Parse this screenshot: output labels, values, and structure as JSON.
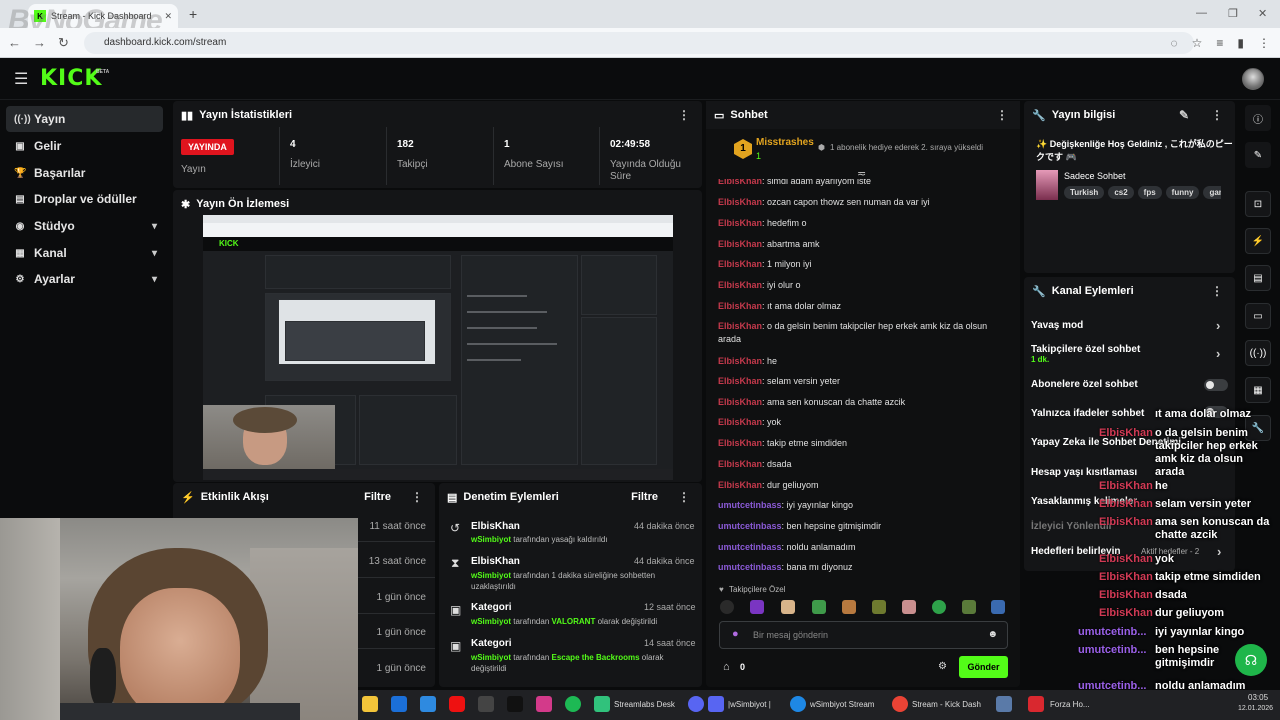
{
  "browser": {
    "tab_title": "Stream - Kick Dashboard",
    "url": "dashboard.kick.com/stream",
    "watermark": "ByNoGame"
  },
  "header": {
    "logo": "KICK",
    "beta": "BETA"
  },
  "sidebar": {
    "items": [
      {
        "label": "Yayın",
        "icon": "broadcast-icon"
      },
      {
        "label": "Gelir",
        "icon": "money-icon"
      },
      {
        "label": "Başarılar",
        "icon": "trophy-icon"
      },
      {
        "label": "Droplar ve ödüller",
        "icon": "gift-icon"
      },
      {
        "label": "Stüdyo",
        "icon": "studio-icon"
      },
      {
        "label": "Kanal",
        "icon": "channel-icon"
      },
      {
        "label": "Ayarlar",
        "icon": "gear-icon"
      }
    ]
  },
  "stats": {
    "title": "Yayın İstatistikleri",
    "live_badge": "YAYINDA",
    "live_label": "Yayın",
    "viewers_value": "4",
    "viewers_label": "İzleyici",
    "followers_value": "182",
    "followers_label": "Takipçi",
    "subs_value": "1",
    "subs_label": "Abone Sayısı",
    "uptime_value": "02:49:58",
    "uptime_label": "Yayında Olduğu Süre"
  },
  "preview": {
    "title": "Yayın Ön İzlemesi"
  },
  "activity": {
    "title": "Etkinlik Akışı",
    "filter": "Filtre",
    "times": [
      "11 saat önce",
      "13 saat önce",
      "1 gün önce",
      "1 gün önce",
      "1 gün önce"
    ]
  },
  "moderation": {
    "title": "Denetim Eylemleri",
    "filter": "Filtre",
    "items": [
      {
        "title": "ElbisKhan",
        "time": "44 dakika önce",
        "actor": "wSimbiyot",
        "rest": " tarafından yasağı kaldırıldı"
      },
      {
        "title": "ElbisKhan",
        "time": "44 dakika önce",
        "actor": "wSimbiyot",
        "rest": " tarafından 1 dakika süreliğine sohbetten uzaklaştırıldı"
      },
      {
        "title": "Kategori",
        "time": "12 saat önce",
        "actor": "wSimbiyot",
        "rest": " tarafından ",
        "highlight": "VALORANT",
        "rest2": " olarak değiştirildi"
      },
      {
        "title": "Kategori",
        "time": "14 saat önce",
        "actor": "wSimbiyot",
        "rest": " tarafından ",
        "highlight": "Escape the Backrooms",
        "rest2": " olarak değiştirildi"
      }
    ]
  },
  "chat": {
    "title": "Sohbet",
    "pinned_user": "Misstrashes",
    "pinned_count": "1",
    "pinned_note": "1 abonelik hediye ederek 2. sıraya yükseldi",
    "messages": [
      {
        "user": "ElbisKhan",
        "text": ": simdi adam ayarlıyom iste"
      },
      {
        "user": "ElbisKhan",
        "text": ": ozcan capon thowz sen numan da var iyi"
      },
      {
        "user": "ElbisKhan",
        "text": ": hedefim o"
      },
      {
        "user": "ElbisKhan",
        "text": ": abartma amk"
      },
      {
        "user": "ElbisKhan",
        "text": ": 1 milyon iyi"
      },
      {
        "user": "ElbisKhan",
        "text": ": iyi olur o"
      },
      {
        "user": "ElbisKhan",
        "text": ": ıt ama dolar olmaz"
      },
      {
        "user": "ElbisKhan",
        "text": ": o da gelsin benim takipciler hep erkek amk kiz da olsun arada"
      },
      {
        "user": "ElbisKhan",
        "text": ": he"
      },
      {
        "user": "ElbisKhan",
        "text": ": selam versin yeter"
      },
      {
        "user": "ElbisKhan",
        "text": ": ama sen konuscan da chatte azcik"
      },
      {
        "user": "ElbisKhan",
        "text": ": yok"
      },
      {
        "user": "ElbisKhan",
        "text": ": takip etme simdiden"
      },
      {
        "user": "ElbisKhan",
        "text": ": dsada"
      },
      {
        "user": "ElbisKhan",
        "text": ": dur geliuyom"
      },
      {
        "user": "umutcetinbass",
        "text": ": iyi yayınlar kingo"
      },
      {
        "user": "umutcetinbass",
        "text": ": ben hepsine gitmişimdir"
      },
      {
        "user": "umutcetinbass",
        "text": ": noldu anlamadım"
      },
      {
        "user": "umutcetinbass",
        "text": ": bana mı diyonuz"
      }
    ],
    "followers_only": "Takipçilere Özel",
    "input_placeholder": "Bir mesaj gönderin",
    "points": "0",
    "send": "Gönder"
  },
  "stream_info": {
    "title": "Yayın bilgisi",
    "stream_title": "✨ Değişkenliğe Hoş Geldiniz , これが私のピークです 🎮",
    "category": "Sadece Sohbet",
    "tags": [
      "Turkish",
      "cs2",
      "fps",
      "funny",
      "gam"
    ]
  },
  "channel_actions": {
    "title": "Kanal Eylemleri",
    "slow_mode": "Yavaş mod",
    "followers_only": "Takipçilere özel sohbet",
    "followers_only_sub": "1 dk.",
    "subs_only": "Abonelere özel sohbet",
    "emote_only": "Yalnızca ifadeler sohbet",
    "ai_chat": "Yapay Zeka ile Sohbet Denetimi",
    "age_limits": "Hesap yaşı kısıtlaması",
    "banned_words": "Yasaklanmış kelimeler",
    "viewer_guides": "İzleyici Yönlendir",
    "goals": "Hedefleri belirleyin",
    "goals_sub": "Aktif hedefler - 2"
  },
  "overlay": {
    "lines": [
      {
        "name": "",
        "text": "ıt ama dolar olmaz"
      },
      {
        "name": "ElbisKhan",
        "text": "o da gelsin benim takipciler hep erkek amk kiz da olsun arada"
      },
      {
        "name": "ElbisKhan",
        "text": "he"
      },
      {
        "name": "ElbisKhan",
        "text": "selam versin yeter"
      },
      {
        "name": "ElbisKhan",
        "text": "ama sen konuscan da chatte azcik"
      },
      {
        "name": "ElbisKhan",
        "text": "yok"
      },
      {
        "name": "ElbisKhan",
        "text": "takip etme simdiden"
      },
      {
        "name": "ElbisKhan",
        "text": "dsada"
      },
      {
        "name": "ElbisKhan",
        "text": "dur geliuyom"
      },
      {
        "name": "umutcetinb...",
        "text": "iyi yayınlar kingo"
      },
      {
        "name": "umutcetinb...",
        "text": "ben hepsine gitmişimdir"
      },
      {
        "name": "umutcetinb...",
        "text": "noldu anlamadım"
      },
      {
        "name": "umutcetinb...",
        "text": "bana mı diyonuz"
      }
    ]
  },
  "taskbar": {
    "items": [
      "Streamlabs Desk",
      "|wSimbiyot |",
      "wSimbiyot Stream",
      "Stream - Kick Dash",
      "Forza Ho..."
    ],
    "time": "03:05",
    "date": "12.01.2026"
  },
  "colors": {
    "kick_green": "#53fc18",
    "live_red": "#e0141e",
    "chat_red": "#c4394c",
    "chat_purple": "#8a5ad6"
  }
}
